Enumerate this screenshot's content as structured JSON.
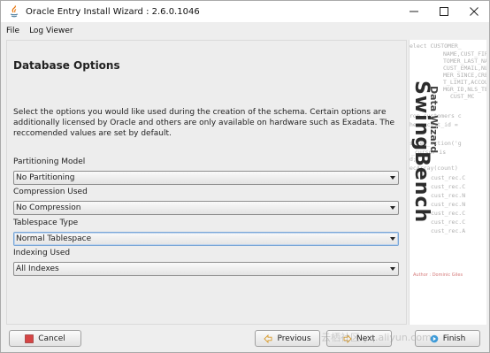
{
  "window": {
    "title": "Oracle Entry Install Wizard : 2.6.0.1046",
    "controls": {
      "minimize": "—",
      "maximize": "☐",
      "close": "✕"
    }
  },
  "menu": {
    "items": [
      "File",
      "Log Viewer"
    ]
  },
  "page": {
    "title": "Database Options",
    "description": "Select the options you would like used during the creation of the schema. Certain options are additionally licensed by Oracle and others are only available on hardware such as Exadata. The reccomended values are set by default."
  },
  "fields": [
    {
      "label": "Partitioning Model",
      "value": "No Partitioning"
    },
    {
      "label": "Compression Used",
      "value": "No Compression"
    },
    {
      "label": "Tablespace Type",
      "value": "Normal Tablespace"
    },
    {
      "label": "Indexing Used",
      "value": "All Indexes"
    }
  ],
  "banner": {
    "brand": "SwingBench",
    "subtitle": "Data Wizard",
    "code_lines": [
      "elect CUSTOMER_",
      "NAME,CUST_FIRST",
      "TOMER_LAST_NAM",
      "CUST_EMAIL,NLS",
      "MER_SINCE,CREDI",
      "T_LIMIT,ACCOUNT",
      "MGR_ID,NLS_TERR",
      "CUST_MC",
      "rom customers c",
      "here cust_id =",
      "",
      "s.set_action('g",
      "_cursor is",
      "d;",
      "ecArray(count)",
      "cust_rec.C",
      "cust_rec.C",
      "cust_rec.N",
      "cust_rec.N",
      "cust_rec.C",
      "cust_rec.C",
      "cust_rec.A"
    ],
    "author": "Author : Dominic Giles"
  },
  "buttons": {
    "cancel": "Cancel",
    "previous": "Previous",
    "next": "Next",
    "finish": "Finish"
  },
  "watermark": "云栖社区 yq.aliyun.com",
  "colors": {
    "cancel_icon": "#d64545",
    "arrow_icon": "#e0a030",
    "finish_icon": "#3f9bd8"
  }
}
